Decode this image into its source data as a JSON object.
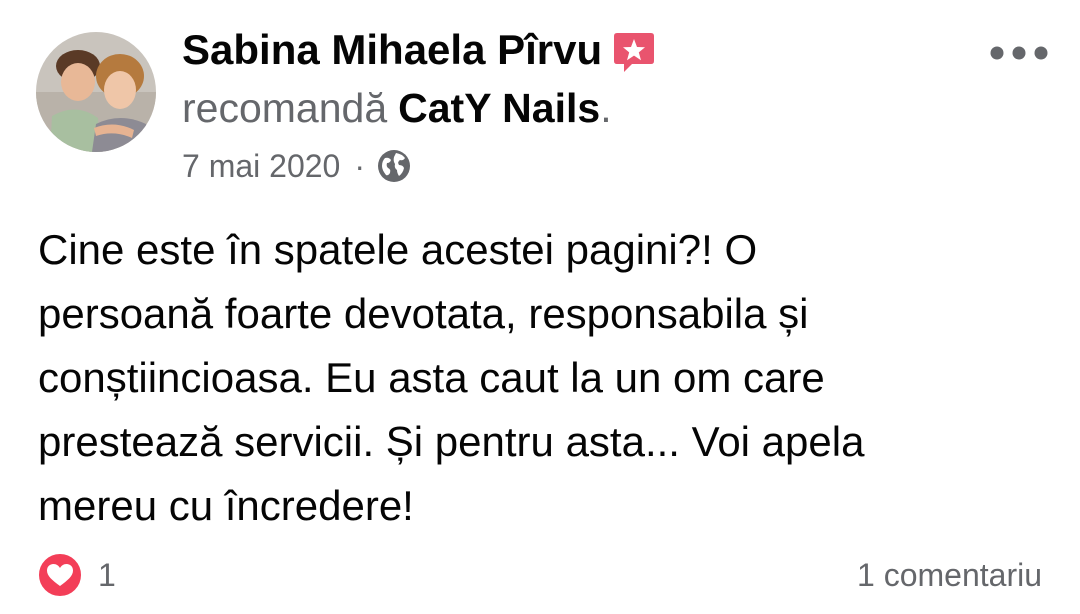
{
  "author": {
    "name": "Sabina Mihaela Pîrvu",
    "badge_icon": "recommendation-star-icon"
  },
  "recommendation": {
    "verb": "recomandă",
    "page_name": "CatY Nails",
    "trailing": "."
  },
  "meta": {
    "date": "7 mai 2020",
    "separator": "·",
    "audience_icon": "globe-icon"
  },
  "post": {
    "lines": [
      "Cine este în spatele acestei pagini?! O",
      "persoană foarte devotata, responsabila și",
      "conștiincioasa. Eu asta caut la un om care",
      "prestează servicii. Și pentru asta... Voi apela",
      "mereu cu încredere!"
    ]
  },
  "footer": {
    "reaction_icon": "heart-icon",
    "reaction_count": "1",
    "comments_label": "1 comentariu"
  },
  "colors": {
    "text_primary": "#050505",
    "text_secondary": "#65676b",
    "heart": "#f33e58",
    "badge": "#e9546e"
  }
}
